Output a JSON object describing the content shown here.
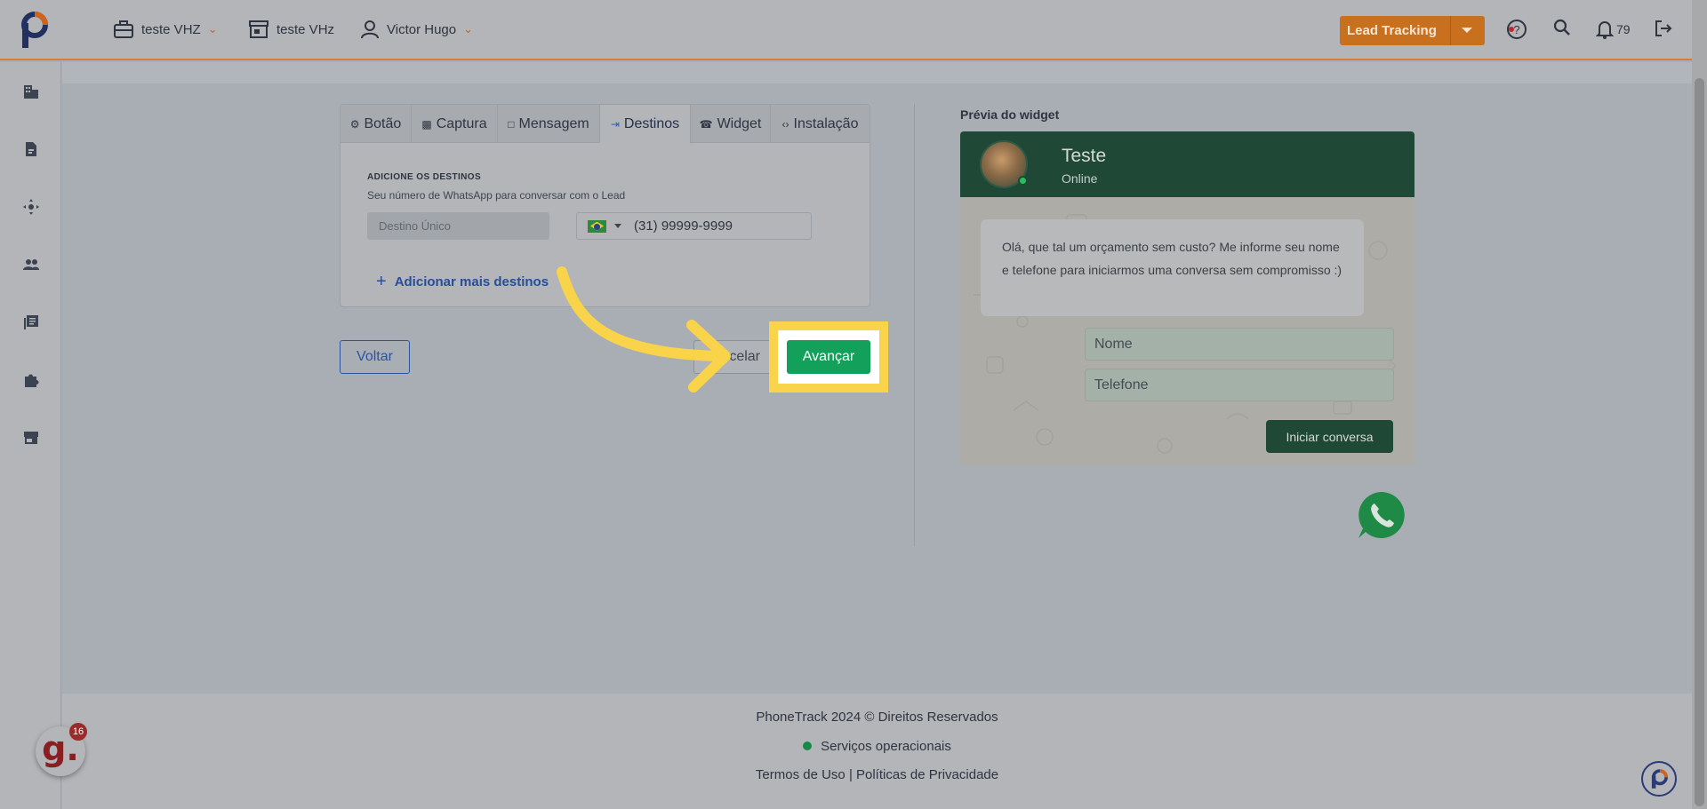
{
  "header": {
    "company": "teste VHZ",
    "store": "teste VHz",
    "user": "Victor Hugo",
    "lead_tracking": "Lead Tracking",
    "notifications_count": "79"
  },
  "sidebar": {
    "items": [
      "building-icon",
      "report-icon",
      "move-icon",
      "users-icon",
      "library-icon",
      "puzzle-icon",
      "store-icon"
    ]
  },
  "tabs": [
    {
      "label": "Botão",
      "icon": "gear-icon"
    },
    {
      "label": "Captura",
      "icon": "dashboard-icon"
    },
    {
      "label": "Mensagem",
      "icon": "message-icon"
    },
    {
      "label": "Destinos",
      "icon": "login-icon",
      "active": true
    },
    {
      "label": "Widget",
      "icon": "whatsapp-icon"
    },
    {
      "label": "Instalação",
      "icon": "code-icon"
    }
  ],
  "destinations": {
    "title": "ADICIONE OS DESTINOS",
    "subtitle": "Seu número de WhatsApp para conversar com o Lead",
    "name_placeholder": "Destino Único",
    "phone_value": "(31) 99999-9999",
    "add_more": "Adicionar mais destinos"
  },
  "actions": {
    "back": "Voltar",
    "cancel": "Cancelar",
    "next": "Avançar"
  },
  "preview": {
    "label": "Prévia do widget",
    "name": "Teste",
    "status": "Online",
    "message": "Olá, que tal um orçamento sem custo? Me informe seu nome e telefone para iniciarmos uma conversa sem compromisso :)",
    "name_field": "Nome",
    "phone_field": "Telefone",
    "start_button": "Iniciar conversa"
  },
  "footer": {
    "copyright": "PhoneTrack 2024 © Direitos Reservados",
    "status": "Serviços operacionais",
    "links": "Termos de Uso | Políticas de Privacidade"
  },
  "widgets": {
    "g_count": "16"
  },
  "colors": {
    "accent": "#d57e36",
    "lead_button": "#c8701e",
    "primary_green": "#13a05a",
    "whatsapp_dark": "#1f4837",
    "highlight": "#f9d34a"
  }
}
